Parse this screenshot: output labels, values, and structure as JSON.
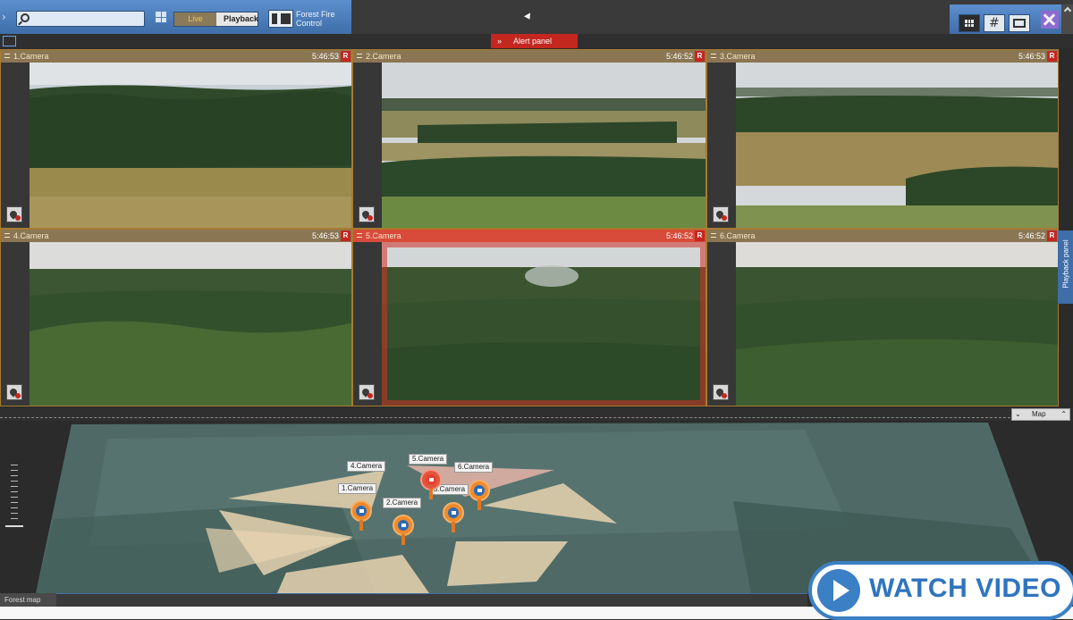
{
  "toolbar": {
    "search_placeholder": "",
    "mode_live": "Live",
    "mode_playback": "Playback",
    "layout_title": "Forest Fire Control",
    "layout_title_line1": "Forest Fire",
    "layout_title_line2": "Control"
  },
  "alert_panel": {
    "label": "Alert panel",
    "chevron": "»"
  },
  "cameras": [
    {
      "name": "1.Camera",
      "time": "5:46:53",
      "rec": "R",
      "alert": false
    },
    {
      "name": "2.Camera",
      "time": "5:46:52",
      "rec": "R",
      "alert": false
    },
    {
      "name": "3.Camera",
      "time": "5:46:53",
      "rec": "R",
      "alert": false
    },
    {
      "name": "4.Camera",
      "time": "5:46:53",
      "rec": "R",
      "alert": false
    },
    {
      "name": "5.Camera",
      "time": "5:46:52",
      "rec": "R",
      "alert": true
    },
    {
      "name": "6.Camera",
      "time": "5:46:52",
      "rec": "R",
      "alert": false
    }
  ],
  "playback_panel": {
    "label": "Playback panel"
  },
  "map": {
    "button_label": "Map",
    "tab_label": "Forest map",
    "camera_labels": [
      "1.Camera",
      "2.Camera",
      "3.Camera",
      "4.Camera",
      "5.Camera",
      "6.Camera"
    ]
  },
  "watch_video": {
    "label": "WATCH VIDEO"
  },
  "colors": {
    "accent_blue": "#3f6ea8",
    "alert_red": "#c42620",
    "camera_header": "#8a7652"
  }
}
